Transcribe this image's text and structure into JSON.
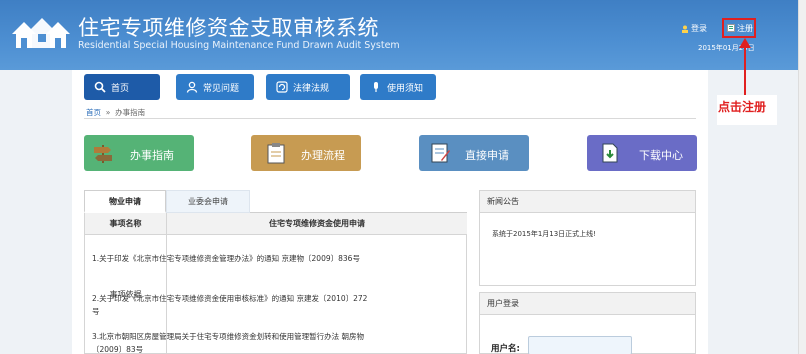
{
  "header": {
    "title_cn": "住宅专项维修资金支取审核系统",
    "title_en": "Residential Special Housing Maintenance Fund Drawn Audit System",
    "login_label": "登录",
    "register_label": "注册",
    "date": "2015年01月20日"
  },
  "annotation": {
    "text": "点击注册"
  },
  "nav": {
    "items": [
      {
        "label": "首页",
        "icon": "search-icon"
      },
      {
        "label": "常见问题",
        "icon": "user-icon"
      },
      {
        "label": "法律法规",
        "icon": "refresh-icon"
      },
      {
        "label": "使用须知",
        "icon": "microphone-icon"
      }
    ]
  },
  "breadcrumb": {
    "home": "首页",
    "sep": "»",
    "current": "办事指南"
  },
  "quick": [
    {
      "label": "办事指南",
      "color": "#55b376",
      "icon": "signpost-icon"
    },
    {
      "label": "办理流程",
      "color": "#c79b52",
      "icon": "clipboard-icon"
    },
    {
      "label": "直接申请",
      "color": "#5a8fc1",
      "icon": "form-icon"
    },
    {
      "label": "下载中心",
      "color": "#6a6cc6",
      "icon": "download-icon"
    }
  ],
  "tabs": [
    "物业申请",
    "业委会申请"
  ],
  "table": {
    "header_name": "事项名称",
    "header_value": "住宅专项维修资金使用申请",
    "row_label": "事项依据",
    "laws": [
      "1.关于印发《北京市住宅专项维修资金管理办法》的通知 京建物〔2009〕836号",
      "2.关于印发《北京市住宅专项维修资金使用审核标准》的通知 京建发〔2010〕272号",
      "3.北京市朝阳区房屋管理局关于住宅专项维修资金划转和使用管理暂行办法 朝房物〔2009〕83号"
    ]
  },
  "news": {
    "title": "新闻公告",
    "items": [
      "系统于2015年1月13日正式上线!"
    ]
  },
  "login": {
    "title": "用户登录",
    "username_label": "用户名:",
    "username_value": ""
  }
}
